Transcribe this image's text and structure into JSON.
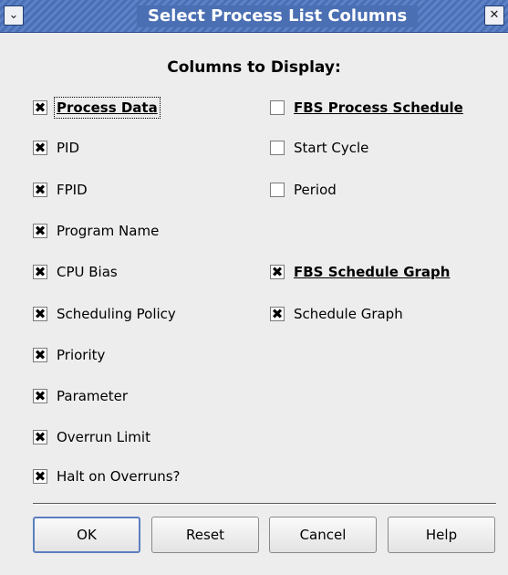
{
  "window": {
    "title": "Select Process List Columns",
    "menu_glyph": "⌄",
    "close_glyph": "✕"
  },
  "heading": "Columns to Display:",
  "check_glyph": "✖",
  "left_column": [
    {
      "label": "Process Data",
      "checked": true,
      "bold": true,
      "focused": true
    },
    {
      "label": "PID",
      "checked": true
    },
    {
      "label": "FPID",
      "checked": true
    },
    {
      "label": "Program Name",
      "checked": true
    },
    {
      "label": "CPU Bias",
      "checked": true
    },
    {
      "label": "Scheduling Policy",
      "checked": true
    },
    {
      "label": "Priority",
      "checked": true
    },
    {
      "label": "Parameter",
      "checked": true
    },
    {
      "label": "Overrun Limit",
      "checked": true
    },
    {
      "label": "Halt on Overruns?",
      "checked": true
    }
  ],
  "right_column": [
    {
      "label": "FBS Process Schedule",
      "checked": false,
      "bold": true
    },
    {
      "label": "Start Cycle",
      "checked": false
    },
    {
      "label": "Period",
      "checked": false
    },
    {
      "label": "FBS Schedule Graph",
      "checked": true,
      "bold": true
    },
    {
      "label": "Schedule Graph",
      "checked": true
    }
  ],
  "buttons": {
    "ok": "OK",
    "reset": "Reset",
    "cancel": "Cancel",
    "help": "Help"
  },
  "colors": {
    "titlebar": "#4a6fb5",
    "background": "#ededed",
    "default_button_border": "#5b7fc0"
  }
}
